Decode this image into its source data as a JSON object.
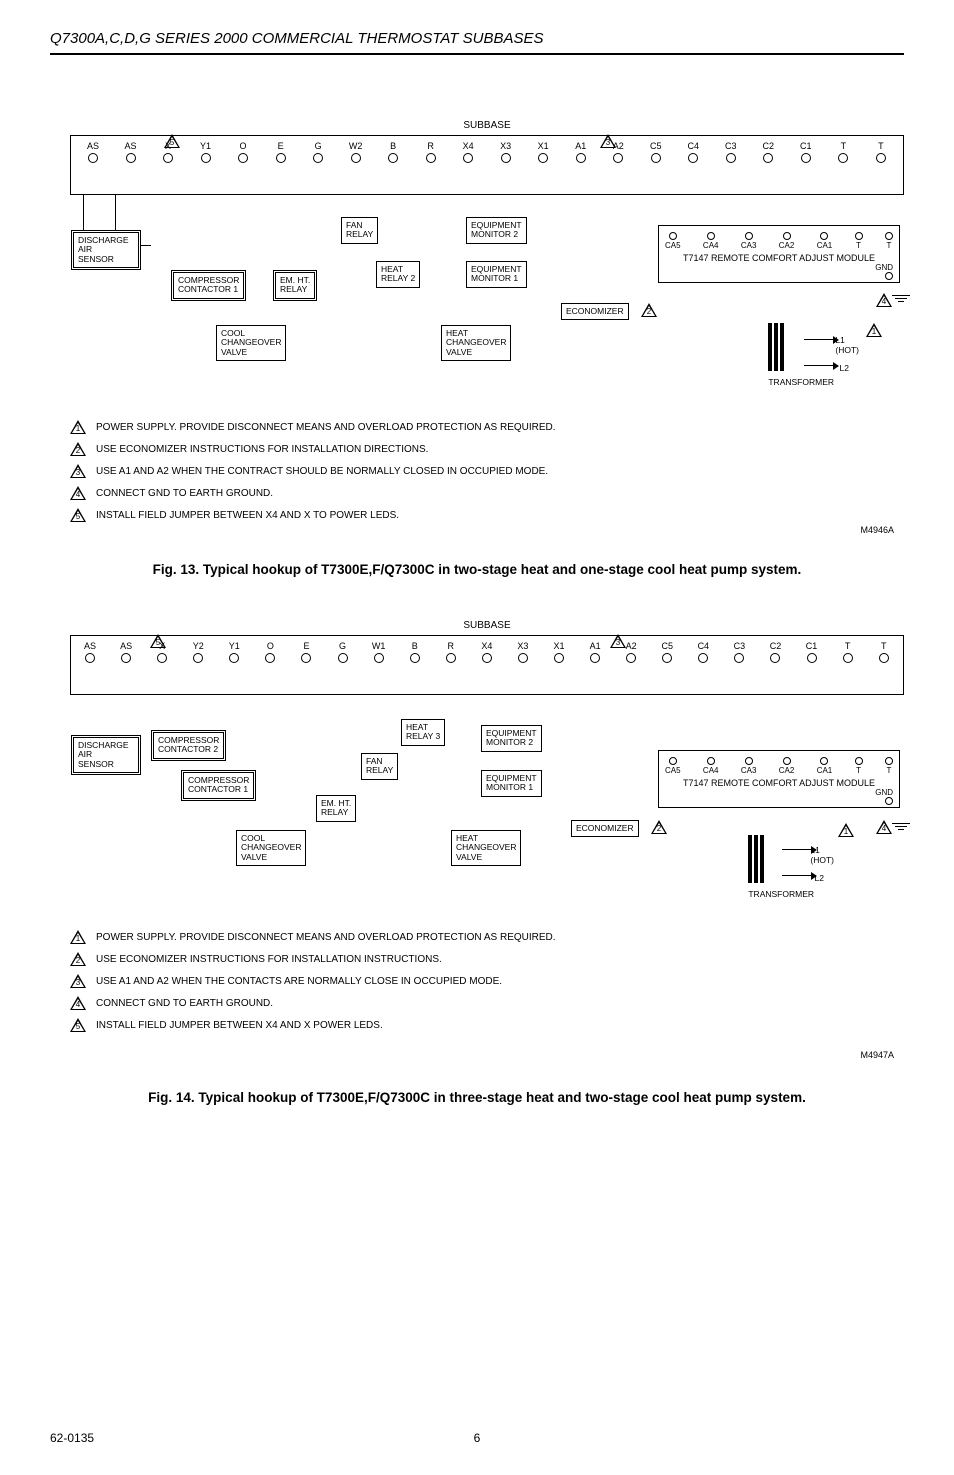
{
  "header": "Q7300A,C,D,G SERIES 2000 COMMERCIAL THERMOSTAT SUBBASES",
  "subbase_label": "SUBBASE",
  "fig13": {
    "caption": "Fig. 13. Typical hookup of T7300E,F/Q7300C in two-stage heat and one-stage cool heat pump system.",
    "terminals": [
      "AS",
      "AS",
      "X",
      "Y1",
      "O",
      "E",
      "G",
      "W2",
      "B",
      "R",
      "X4",
      "X3",
      "X1",
      "A1",
      "A2",
      "C5",
      "C4",
      "C3",
      "C2",
      "C1",
      "T",
      "T"
    ],
    "module_label": "T7147 REMOTE COMFORT ADJUST MODULE",
    "module_terms": [
      "CA5",
      "CA4",
      "CA3",
      "CA2",
      "CA1",
      "T",
      "T"
    ],
    "gnd": "GND",
    "boxes": {
      "discharge": "DISCHARGE\nAIR\nSENSOR",
      "compressor1": "COMPRESSOR\nCONTACTOR 1",
      "emht": "EM. HT.\nRELAY",
      "fan": "FAN\nRELAY",
      "heat2": "HEAT\nRELAY 2",
      "coolcv": "COOL\nCHANGEOVER\nVALVE",
      "heatcv": "HEAT\nCHANGEOVER\nVALVE",
      "eq2": "EQUIPMENT\nMONITOR 2",
      "eq1": "EQUIPMENT\nMONITOR 1",
      "econ": "ECONOMIZER"
    },
    "tx": "TRANSFORMER",
    "l1": "L1\n(HOT)",
    "l2": "L2",
    "mref": "M4946A",
    "notes": [
      "POWER SUPPLY.  PROVIDE DISCONNECT MEANS AND OVERLOAD PROTECTION AS REQUIRED.",
      "USE ECONOMIZER INSTRUCTIONS FOR INSTALLATION DIRECTIONS.",
      "USE A1 AND A2 WHEN THE CONTRACT SHOULD BE NORMALLY  CLOSED IN OCCUPIED MODE.",
      "CONNECT GND TO EARTH GROUND.",
      "INSTALL FIELD JUMPER BETWEEN X4 AND X TO POWER LEDS."
    ]
  },
  "fig14": {
    "caption": "Fig. 14. Typical hookup of T7300E,F/Q7300C in three-stage heat and two-stage cool heat pump system.",
    "terminals": [
      "AS",
      "AS",
      "X",
      "Y2",
      "Y1",
      "O",
      "E",
      "G",
      "W1",
      "B",
      "R",
      "X4",
      "X3",
      "X1",
      "A1",
      "A2",
      "C5",
      "C4",
      "C3",
      "C2",
      "C1",
      "T",
      "T"
    ],
    "module_label": "T7147 REMOTE COMFORT ADJUST MODULE",
    "module_terms": [
      "CA5",
      "CA4",
      "CA3",
      "CA2",
      "CA1",
      "T",
      "T"
    ],
    "gnd": "GND",
    "boxes": {
      "discharge": "DISCHARGE\nAIR\nSENSOR",
      "compressor2": "COMPRESSOR\nCONTACTOR 2",
      "compressor1": "COMPRESSOR\nCONTACTOR 1",
      "emht": "EM. HT.\nRELAY",
      "fan": "FAN\nRELAY",
      "heat3": "HEAT\nRELAY 3",
      "coolcv": "COOL\nCHANGEOVER\nVALVE",
      "heatcv": "HEAT\nCHANGEOVER\nVALVE",
      "eq2": "EQUIPMENT\nMONITOR 2",
      "eq1": "EQUIPMENT\nMONITOR 1",
      "econ": "ECONOMIZER"
    },
    "tx": "TRANSFORMER",
    "l1": "L1\n(HOT)",
    "l2": "L2",
    "mref": "M4947A",
    "notes": [
      "POWER SUPPLY.  PROVIDE DISCONNECT MEANS AND OVERLOAD PROTECTION AS REQUIRED.",
      "USE ECONOMIZER INSTRUCTIONS FOR INSTALLATION INSTRUCTIONS.",
      "USE A1 AND A2 WHEN THE CONTACTS ARE NORMALLY CLOSE IN OCCUPIED MODE.",
      "CONNECT GND TO EARTH GROUND.",
      "INSTALL FIELD JUMPER BETWEEN X4 AND X POWER LEDS."
    ]
  },
  "footer_left": "62-0135",
  "footer_center": "6"
}
